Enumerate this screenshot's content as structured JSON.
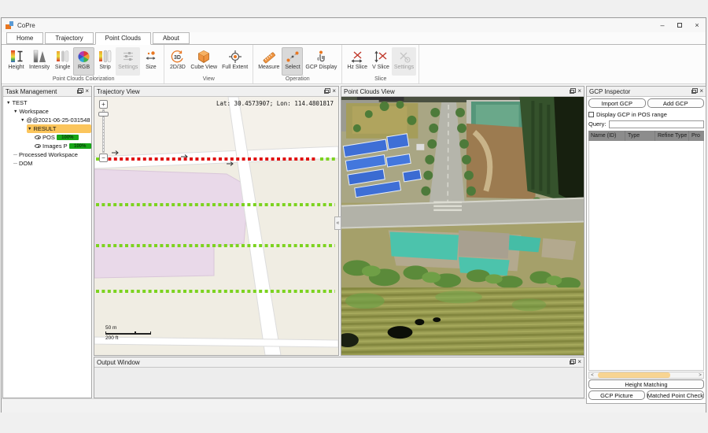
{
  "window": {
    "title": "CoPre"
  },
  "window_controls": {
    "minimize": "–",
    "close": "×"
  },
  "tabs": [
    {
      "label": "Home",
      "active": false
    },
    {
      "label": "Trajectory",
      "active": false
    },
    {
      "label": "Point Clouds",
      "active": true
    },
    {
      "label": "About",
      "active": false
    }
  ],
  "ribbon": {
    "groups": [
      {
        "label": "Point Clouds Colorization",
        "buttons": [
          {
            "label": "Height",
            "icon": "height-colorbar-icon",
            "state": "normal"
          },
          {
            "label": "Intensity",
            "icon": "intensity-histogram-icon",
            "state": "normal"
          },
          {
            "label": "Single",
            "icon": "single-color-icon",
            "state": "normal"
          },
          {
            "label": "RGB",
            "icon": "rgb-wheel-icon",
            "state": "selected"
          },
          {
            "label": "Strip",
            "icon": "strip-color-icon",
            "state": "normal"
          },
          {
            "label": "Settings",
            "icon": "settings-sliders-icon",
            "state": "disabled"
          },
          {
            "label": "Size",
            "icon": "point-size-icon",
            "state": "normal"
          }
        ]
      },
      {
        "label": "View",
        "buttons": [
          {
            "label": "2D/3D",
            "icon": "toggle-2d3d-icon",
            "state": "normal"
          },
          {
            "label": "Cube View",
            "icon": "cube-view-icon",
            "state": "normal"
          },
          {
            "label": "Full Extent",
            "icon": "full-extent-icon",
            "state": "normal"
          }
        ]
      },
      {
        "label": "Operation",
        "buttons": [
          {
            "label": "Measure",
            "icon": "measure-icon",
            "state": "normal"
          },
          {
            "label": "Select",
            "icon": "select-points-icon",
            "state": "selected"
          },
          {
            "label": "GCP Display",
            "icon": "gcp-display-icon",
            "state": "normal"
          }
        ]
      },
      {
        "label": "Slice",
        "buttons": [
          {
            "label": "Hz Slice",
            "icon": "hz-slice-icon",
            "state": "normal"
          },
          {
            "label": "V Slice",
            "icon": "v-slice-icon",
            "state": "normal"
          },
          {
            "label": "Settings",
            "icon": "slice-settings-icon",
            "state": "disabled"
          }
        ]
      }
    ]
  },
  "task_management": {
    "title": "Task Management",
    "tree": [
      {
        "label": "TEST",
        "indent": 0,
        "expander": true
      },
      {
        "label": "Workspace",
        "indent": 1,
        "expander": true
      },
      {
        "label": "@@2021-06-25-031548",
        "indent": 2,
        "expander": true
      },
      {
        "label": "RESULT",
        "indent": 3,
        "expander": true,
        "highlight": true
      },
      {
        "label": "POS",
        "indent": 4,
        "eye": true,
        "progress": "100%"
      },
      {
        "label": "Images P",
        "indent": 4,
        "eye": true,
        "progress": "100%"
      },
      {
        "label": "Processed Workspace",
        "indent": 1,
        "expander": false
      },
      {
        "label": "DOM",
        "indent": 1,
        "expander": false
      }
    ]
  },
  "trajectory_view": {
    "title": "Trajectory View",
    "coordinates": "Lat: 30.4573907; Lon: 114.4801817",
    "scale_metric": "50 m",
    "scale_imperial": "200 ft",
    "zoom_in": "+",
    "zoom_out": "−",
    "collapse_glyph": "«"
  },
  "point_clouds_view": {
    "title": "Point Clouds View"
  },
  "gcp_inspector": {
    "title": "GCP Inspector",
    "import_button": "Import GCP",
    "add_button": "Add GCP",
    "display_checkbox_label": "Display GCP in POS range",
    "display_checkbox_checked": false,
    "query_label": "Query:",
    "query_value": "",
    "table_headers": [
      "Name (ID)",
      "Type",
      "Refine Type",
      "Pro"
    ],
    "height_matching_button": "Height Matching",
    "gcp_picture_button": "GCP Picture",
    "matched_point_check_button": "Matched Point Check"
  },
  "output_window": {
    "title": "Output Window"
  },
  "colors": {
    "accent_orange": "#e87722",
    "selection_highlight": "#fbc55c",
    "progress_green": "#17a617",
    "trajectory_red": "#e01010",
    "trajectory_green": "#7cd31f",
    "map_background": "#f0ede3",
    "map_block_pink": "#e9d9e9",
    "table_header_gray": "#8c8c8c",
    "scrollbar_thumb": "#f7d492",
    "blue_roof": "#3e6fd6",
    "teal_tarp": "#4cc3ac"
  }
}
